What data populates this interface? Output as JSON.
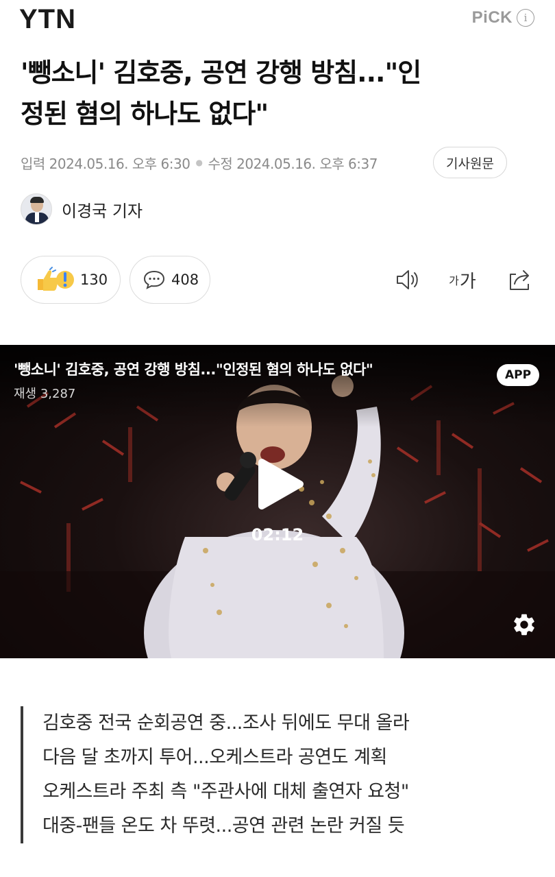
{
  "header": {
    "logo": "YTN",
    "pick_label": "PiCK",
    "info_icon": "i"
  },
  "article": {
    "headline_line1": "'뺑소니' 김호중, 공연 강행 방침...\"인",
    "headline_line2": "정된 혐의 하나도 없다\"",
    "published_label": "입력",
    "published": "2024.05.16. 오후 6:30",
    "modified_label": "수정",
    "modified": "2024.05.16. 오후 6:37",
    "original_button": "기사원문",
    "reporter": "이경국 기자"
  },
  "actions": {
    "reaction_count": "130",
    "comment_count": "408",
    "font_size_label_small": "가",
    "font_size_label_large": "가"
  },
  "video": {
    "title": "'뺑소니' 김호중, 공연 강행 방침...\"인정된 혐의 하나도 없다\"",
    "views": "재생 3,287",
    "app_badge": "APP",
    "duration": "02:12"
  },
  "summary": [
    "김호중 전국 순회공연 중...조사 뒤에도 무대 올라",
    "다음 달 초까지 투어...오케스트라 공연도 계획",
    "오케스트라 주최 측 \"주관사에 대체 출연자 요청\"",
    "대중-팬들 온도 차 뚜렷...공연 관련 논란 커질 듯"
  ],
  "colors": {
    "meta_text": "#8a8a8a",
    "video_bg": "#1a1010",
    "stage_light": "#c0392b"
  }
}
